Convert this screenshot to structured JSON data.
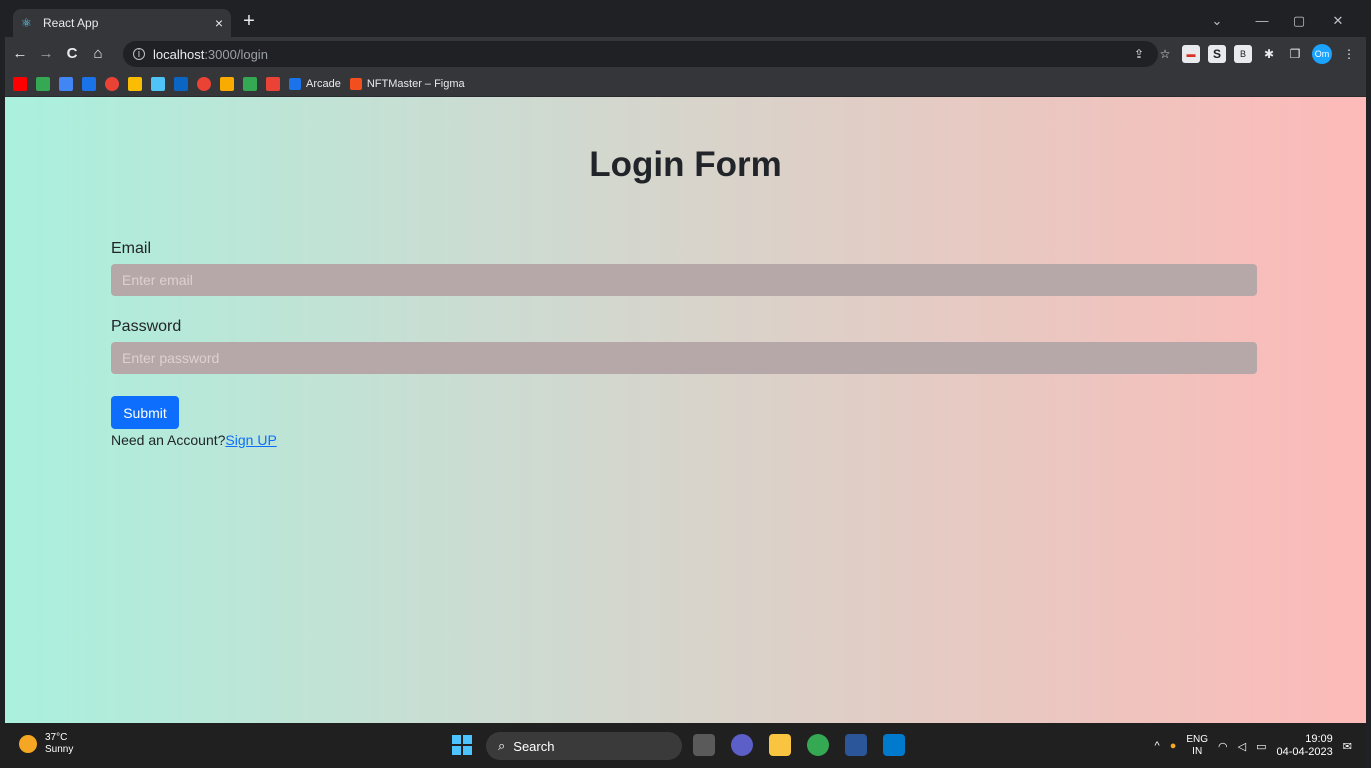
{
  "browser": {
    "tab_title": "React App",
    "tab_close": "×",
    "new_tab": "+",
    "url_host": "localhost",
    "url_path": ":3000/login",
    "back": "←",
    "forward": "→",
    "reload": "C",
    "home": "⌂",
    "share": "⇪",
    "star": "☆",
    "ext_s": "S",
    "ext_b": "B",
    "extensions": "✱",
    "sidepanel": "❐",
    "profile": "Om",
    "menu": "⋮",
    "minimize": "—",
    "maximize": "▢",
    "close": "✕",
    "tabsearch": "⌄"
  },
  "bookmarks": [
    {
      "label": "Arcade",
      "color": "#1a73e8"
    },
    {
      "label": "NFTMaster – Figma",
      "color": "#f24e1e"
    }
  ],
  "page": {
    "heading": "Login Form",
    "email_label": "Email",
    "email_placeholder": "Enter email",
    "password_label": "Password",
    "password_placeholder": "Enter password",
    "submit_label": "Submit",
    "need_text": "Need an Account?",
    "signup_link": "Sign UP"
  },
  "taskbar": {
    "temp": "37°C",
    "condition": "Sunny",
    "search": "Search",
    "lang_top": "ENG",
    "lang_bottom": "IN",
    "time": "19:09",
    "date": "04-04-2023",
    "tray_up": "^"
  },
  "colors": {
    "accent": "#0d6efd",
    "input_bg": "#b6a8a8",
    "gradient_left": "#aaf0dd",
    "gradient_right": "#fdbab8"
  }
}
